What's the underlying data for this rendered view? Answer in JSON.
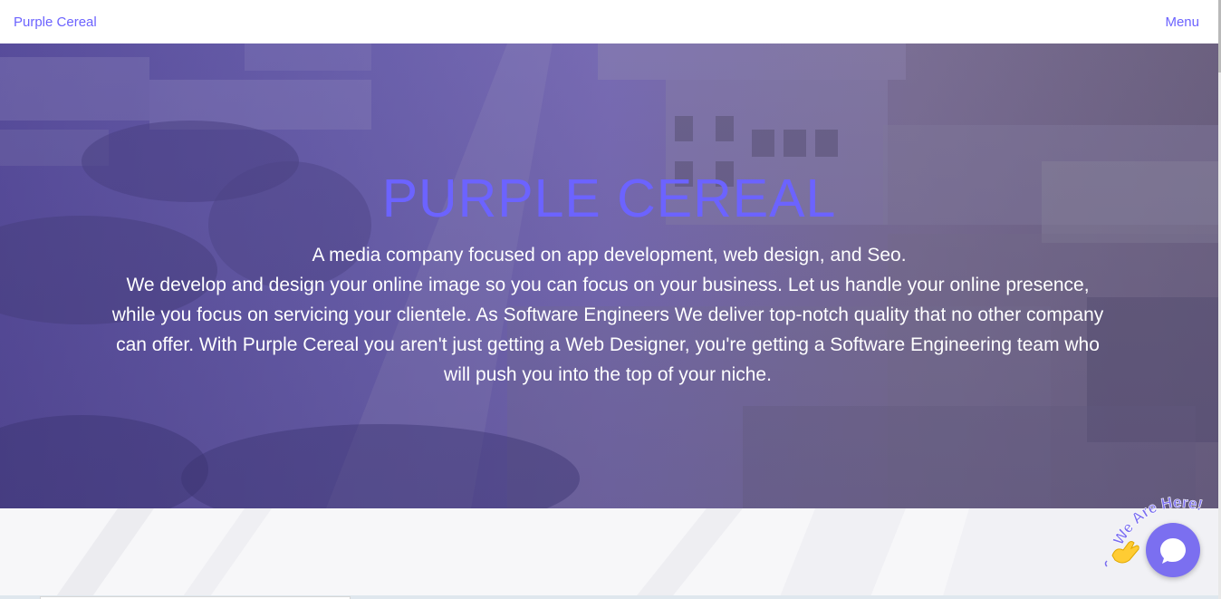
{
  "navbar": {
    "brand": "Purple Cereal",
    "menu_label": "Menu"
  },
  "hero": {
    "title": "PURPLE CEREAL",
    "tagline": "A media company focused on app development, web design, and Seo.",
    "description": "We develop and design your online image so you can focus on your business. Let us handle your online presence, while you focus on servicing your clientele. As Software Engineers We deliver top-notch quality that no other company can offer. With Purple Cereal you aren't just getting a Web Designer, you're getting a Software Engineering team who will push you into the top of your niche."
  },
  "chat_widget": {
    "badge_text": "We Are Here!",
    "icon": "chat-bubble-icon",
    "wave_icon": "waving-hand-icon"
  },
  "colors": {
    "accent": "#6c63ff",
    "chat_button": "#7b6ff0",
    "hero_overlay": "#6d63b0"
  }
}
